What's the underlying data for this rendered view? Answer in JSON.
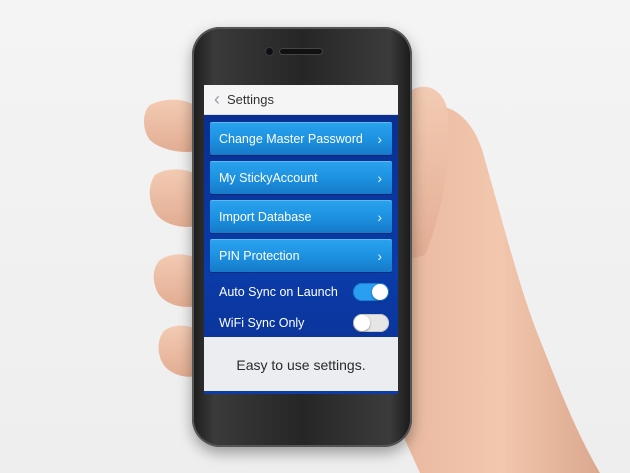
{
  "header": {
    "back_icon": "chevron-left-icon",
    "title": "Settings"
  },
  "menu": {
    "items": [
      {
        "label": "Change Master Password",
        "icon": "chevron-right-icon"
      },
      {
        "label": "My StickyAccount",
        "icon": "chevron-right-icon"
      },
      {
        "label": "Import Database",
        "icon": "chevron-right-icon"
      },
      {
        "label": "PIN Protection",
        "icon": "chevron-right-icon"
      }
    ]
  },
  "toggles": [
    {
      "label": "Auto Sync on Launch",
      "state": "on"
    },
    {
      "label": "WiFi Sync Only",
      "state": "off"
    }
  ],
  "caption": {
    "text": "Easy to use settings."
  },
  "colors": {
    "screen_bg": "#0b3ca9",
    "button_blue": "#1c90e0",
    "toggle_on": "#2a9ef0",
    "toggle_off": "#e6e6e6"
  }
}
